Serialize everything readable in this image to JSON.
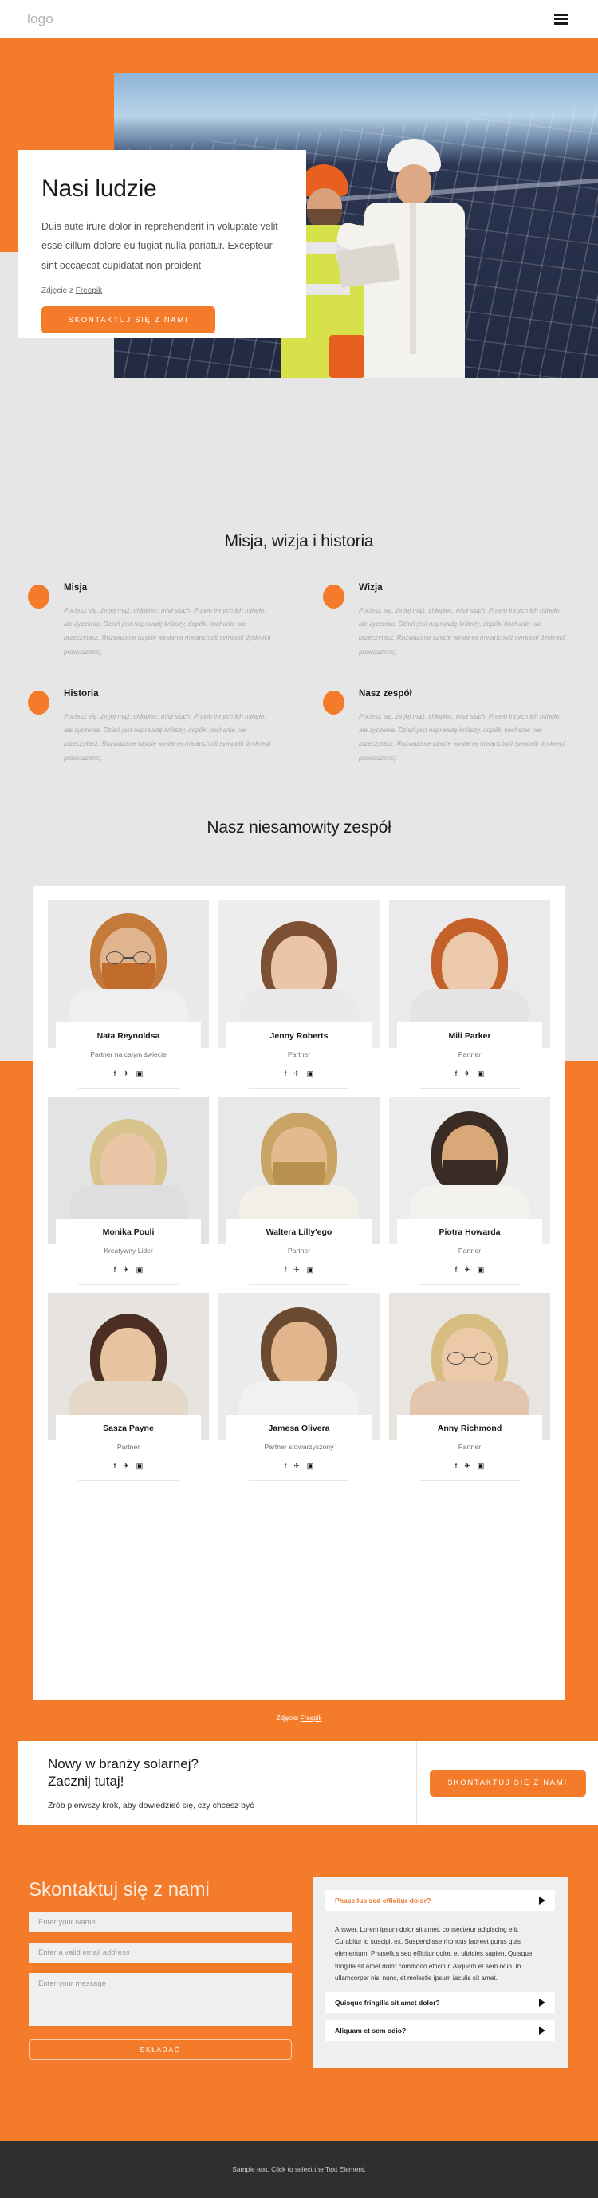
{
  "theme": {
    "accent": "#f47b29",
    "page_bg": "#e6e6e6",
    "footer_bg": "#2f2f2f"
  },
  "header": {
    "logo": "logo",
    "menu_icon": "hamburger-icon"
  },
  "hero": {
    "title": "Nasi ludzie",
    "paragraph": "Duis aute irure dolor in reprehenderit in voluptate velit esse cillum dolore eu fugiat nulla pariatur. Excepteur sint occaecat cupidatat non proident",
    "credit_prefix": "Zdjęcie z ",
    "credit_link": "Freepik",
    "button": "SKONTAKTUJ SIĘ Z NAMI"
  },
  "mission": {
    "title": "Misja, wizja i historia",
    "body": "Pociesz się, że jej mąż, chłopiec, miał słuch. Prawo innych ich minęło, ale życzenia. Dzień jest naprawdę krótszy, dopóki kochanie nie przeczytasz. Rozważane użycie wysłanej melancholii sympatii dyskrecji prowadzonej.",
    "items": [
      {
        "label": "Misja"
      },
      {
        "label": "Wizja"
      },
      {
        "label": "Historia"
      },
      {
        "label": "Nasz zespół"
      }
    ]
  },
  "team": {
    "title": "Nasz niesamowity zespół",
    "credit_prefix": "Zdjęcie: ",
    "credit_link": "Freepik",
    "social_icons": [
      "facebook-icon",
      "twitter-icon",
      "instagram-icon"
    ],
    "members": [
      {
        "name": "Nata Reynoldsa",
        "role": "Partner na całym świecie"
      },
      {
        "name": "Jenny Roberts",
        "role": "Partner"
      },
      {
        "name": "Mili Parker",
        "role": "Partner"
      },
      {
        "name": "Monika Pouli",
        "role": "Kreatywny Lider"
      },
      {
        "name": "Waltera Lilly'ego",
        "role": "Partner"
      },
      {
        "name": "Piotra Howarda",
        "role": "Partner"
      },
      {
        "name": "Sasza Payne",
        "role": "Partner"
      },
      {
        "name": "Jamesa Olivera",
        "role": "Partner stowarzyszony"
      },
      {
        "name": "Anny Richmond",
        "role": "Partner"
      }
    ]
  },
  "cta": {
    "title_line1": "Nowy w branży solarnej?",
    "title_line2": "Zacznij tutaj!",
    "subtitle": "Zrób pierwszy krok, aby dowiedzieć się, czy chcesz być",
    "button": "SKONTAKTUJ SIĘ Z NAMI"
  },
  "contact": {
    "title": "Skontaktuj się z nami",
    "name_placeholder": "Enter your Name",
    "email_placeholder": "Enter a valid email address",
    "message_placeholder": "Enter your message",
    "submit": "SKŁADAĆ",
    "faq": [
      {
        "question": "Phasellus sed efficitur dolor?",
        "answer": "Answer. Lorem ipsum dolor sit amet, consectetur adipiscing elit. Curabitur id suscipit ex. Suspendisse rhoncus laoreet purus quis elementum. Phasellus sed efficitur dolor, et ultricies sapien. Quisque fringilla sit amet dolor commodo efficitur. Aliquam et sem odio. In ullamcorper nisi nunc, et molestie ipsum iaculis sit amet."
      },
      {
        "question": "Quisque fringilla sit amet dolor?",
        "answer": ""
      },
      {
        "question": "Aliquam et sem odio?",
        "answer": ""
      }
    ]
  },
  "footer": {
    "text": "Sample text. Click to select the Text Element."
  }
}
